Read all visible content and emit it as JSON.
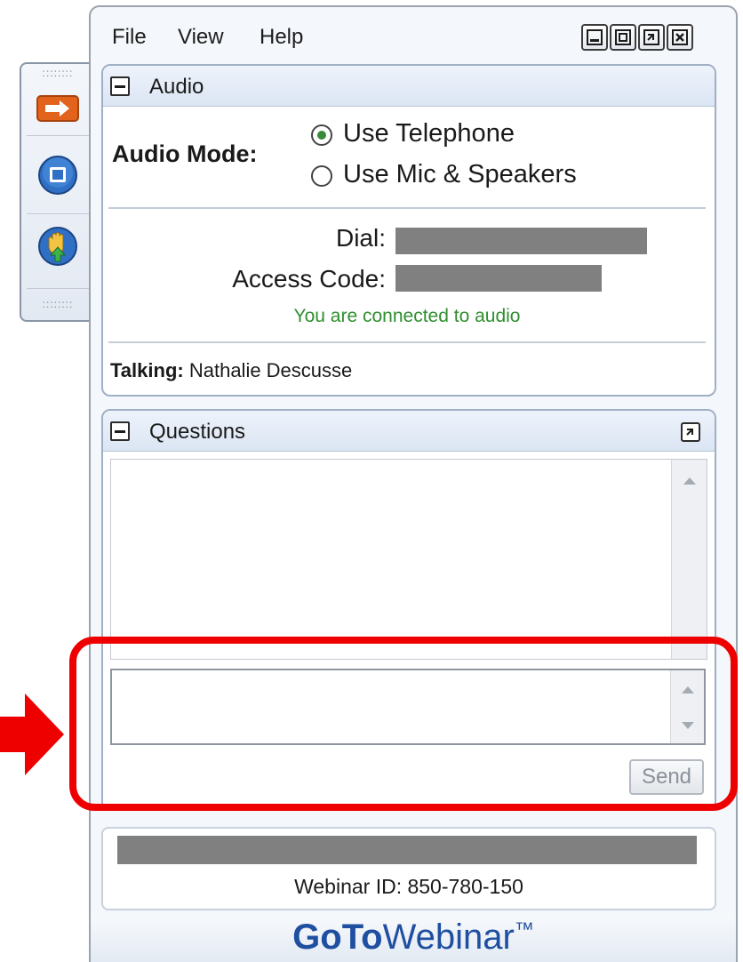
{
  "menu": {
    "file": "File",
    "view": "View",
    "help": "Help"
  },
  "audio_panel": {
    "title": "Audio",
    "mode_label": "Audio Mode:",
    "options": [
      "Use Telephone",
      "Use Mic & Speakers"
    ],
    "selected_option": "Use Telephone",
    "dial_label": "Dial:",
    "access_code_label": "Access Code:",
    "status": "You are connected to audio",
    "talking_label": "Talking:",
    "talking_name": "Nathalie Descusse"
  },
  "questions_panel": {
    "title": "Questions",
    "question_log_value": "",
    "question_input_value": "",
    "send_label": "Send"
  },
  "footer": {
    "webinar_id": "Webinar ID: 850-780-150",
    "brand_bold": "GoTo",
    "brand_light": "Webinar",
    "brand_tm": "™"
  },
  "colors": {
    "status_green": "#2f8f2f",
    "highlight_red": "#ee0000",
    "brand_blue": "#1f4fa0",
    "panel_border": "#9fb0c6"
  },
  "icons": {
    "side_toolbar": [
      "arrow-right-icon",
      "screen-icon",
      "raise-hand-icon"
    ],
    "window_controls": [
      "minimize-icon",
      "restore-icon",
      "popout-icon",
      "close-icon"
    ]
  }
}
